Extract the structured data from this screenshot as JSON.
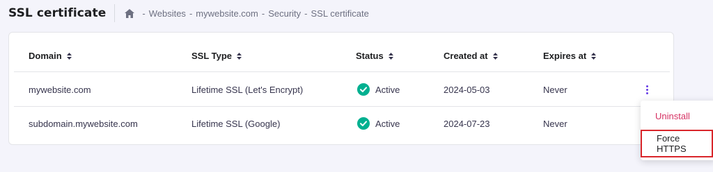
{
  "header": {
    "title": "SSL certificate",
    "breadcrumb": [
      "Websites",
      "mywebsite.com",
      "Security",
      "SSL certificate"
    ],
    "separator": "-"
  },
  "table": {
    "columns": [
      "Domain",
      "SSL Type",
      "Status",
      "Created at",
      "Expires at"
    ],
    "rows": [
      {
        "domain": "mywebsite.com",
        "ssl_type": "Lifetime SSL (Let's Encrypt)",
        "status": "Active",
        "created": "2024-05-03",
        "expires": "Never"
      },
      {
        "domain": "subdomain.mywebsite.com",
        "ssl_type": "Lifetime SSL (Google)",
        "status": "Active",
        "created": "2024-07-23",
        "expires": "Never"
      }
    ]
  },
  "menu": {
    "items": [
      "Uninstall",
      "Force HTTPS"
    ]
  },
  "colors": {
    "accent": "#673de6",
    "success": "#00b090",
    "danger": "#d63163",
    "highlight": "#d9262b"
  }
}
